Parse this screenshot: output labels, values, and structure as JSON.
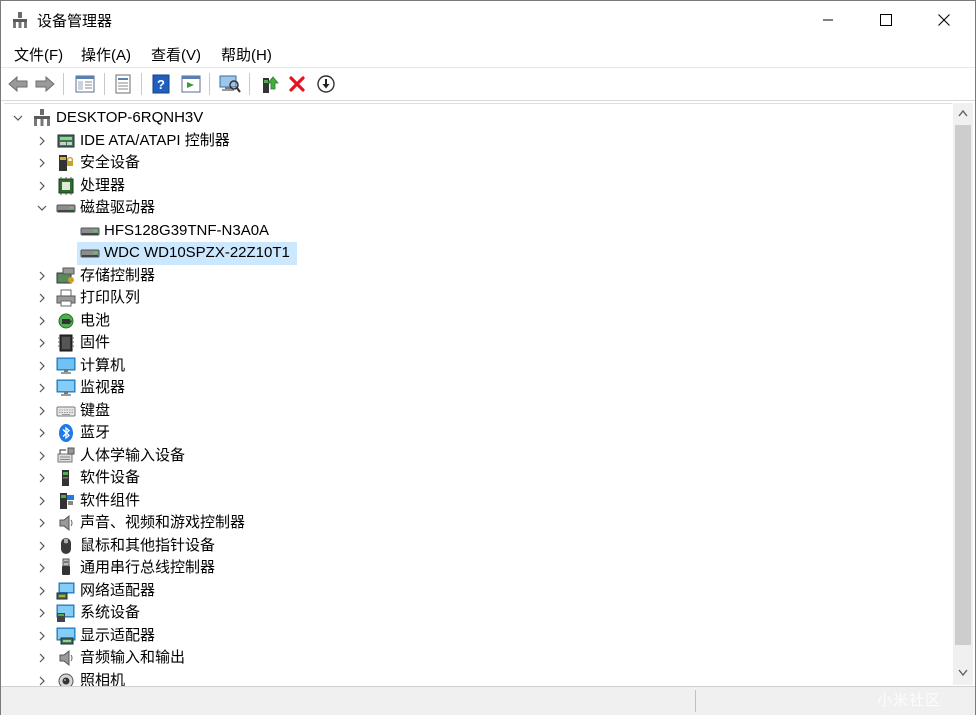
{
  "window": {
    "title": "设备管理器"
  },
  "menu": {
    "items": [
      "文件(F)",
      "操作(A)",
      "查看(V)",
      "帮助(H)"
    ]
  },
  "toolbar": {
    "buttons": [
      "back-icon",
      "forward-icon",
      "properties-pane-icon",
      "properties-icon",
      "help-icon",
      "action-pane-icon",
      "scan-hardware-icon",
      "update-driver-icon",
      "uninstall-icon",
      "disable-icon"
    ]
  },
  "tree": {
    "root": "DESKTOP-6RQNH3V",
    "categories": [
      {
        "label": "IDE ATA/ATAPI 控制器",
        "icon": "ide-controller-icon",
        "expanded": false
      },
      {
        "label": "安全设备",
        "icon": "security-device-icon",
        "expanded": false
      },
      {
        "label": "处理器",
        "icon": "processor-icon",
        "expanded": false
      },
      {
        "label": "磁盘驱动器",
        "icon": "disk-drive-icon",
        "expanded": true,
        "children": [
          {
            "label": "HFS128G39TNF-N3A0A",
            "icon": "disk-drive-icon",
            "selected": false
          },
          {
            "label": "WDC WD10SPZX-22Z10T1",
            "icon": "disk-drive-icon",
            "selected": true
          }
        ]
      },
      {
        "label": "存储控制器",
        "icon": "storage-controller-icon",
        "expanded": false
      },
      {
        "label": "打印队列",
        "icon": "printer-icon",
        "expanded": false
      },
      {
        "label": "电池",
        "icon": "battery-icon",
        "expanded": false
      },
      {
        "label": "固件",
        "icon": "firmware-icon",
        "expanded": false
      },
      {
        "label": "计算机",
        "icon": "computer-icon",
        "expanded": false
      },
      {
        "label": "监视器",
        "icon": "monitor-icon",
        "expanded": false
      },
      {
        "label": "键盘",
        "icon": "keyboard-icon",
        "expanded": false
      },
      {
        "label": "蓝牙",
        "icon": "bluetooth-icon",
        "expanded": false
      },
      {
        "label": "人体学输入设备",
        "icon": "hid-icon",
        "expanded": false
      },
      {
        "label": "软件设备",
        "icon": "software-device-icon",
        "expanded": false
      },
      {
        "label": "软件组件",
        "icon": "software-component-icon",
        "expanded": false
      },
      {
        "label": "声音、视频和游戏控制器",
        "icon": "sound-icon",
        "expanded": false
      },
      {
        "label": "鼠标和其他指针设备",
        "icon": "mouse-icon",
        "expanded": false
      },
      {
        "label": "通用串行总线控制器",
        "icon": "usb-icon",
        "expanded": false
      },
      {
        "label": "网络适配器",
        "icon": "network-adapter-icon",
        "expanded": false
      },
      {
        "label": "系统设备",
        "icon": "system-device-icon",
        "expanded": false
      },
      {
        "label": "显示适配器",
        "icon": "display-adapter-icon",
        "expanded": false
      },
      {
        "label": "音频输入和输出",
        "icon": "audio-io-icon",
        "expanded": false
      },
      {
        "label": "照相机",
        "icon": "camera-icon",
        "expanded": false
      }
    ]
  },
  "watermark": "小米社区",
  "colors": {
    "selection": "#cce8ff",
    "uninstall_red": "#e81123",
    "help_blue": "#1f5fbf"
  }
}
